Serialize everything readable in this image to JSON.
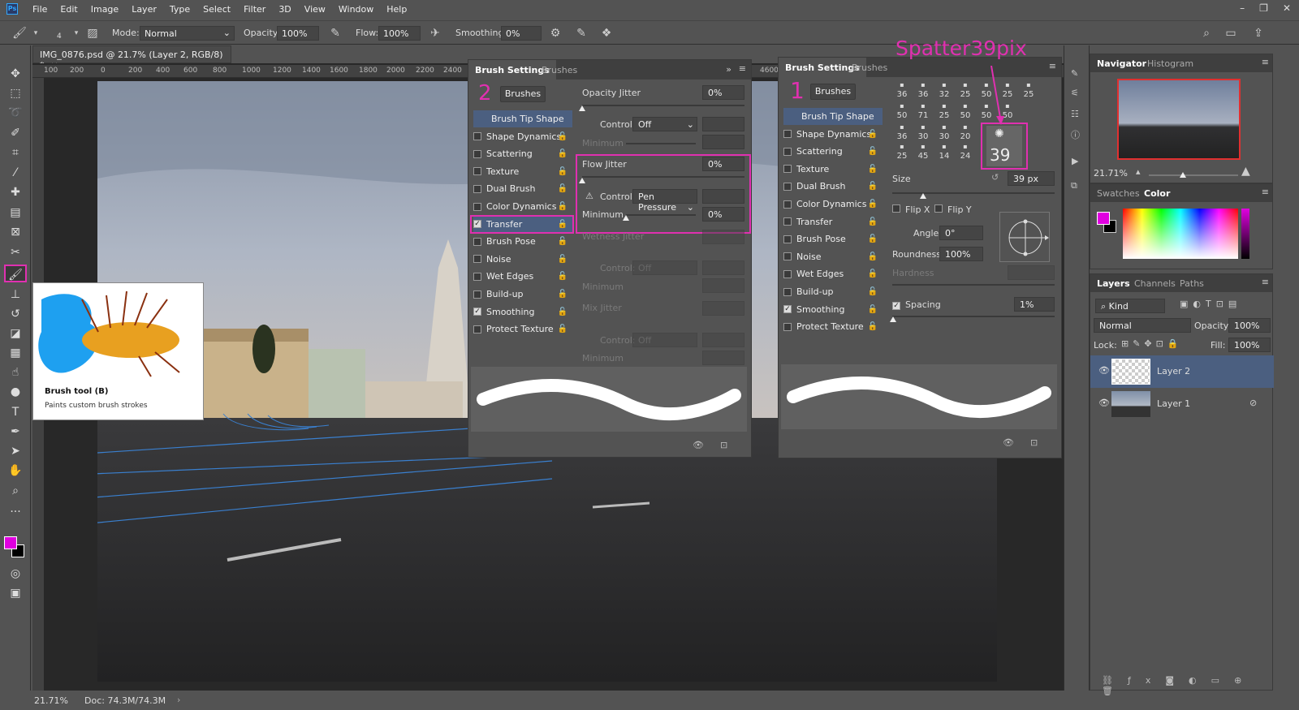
{
  "app": {
    "logo": "Ps"
  },
  "menu": [
    "File",
    "Edit",
    "Image",
    "Layer",
    "Type",
    "Select",
    "Filter",
    "3D",
    "View",
    "Window",
    "Help"
  ],
  "options": {
    "brush_size": "4",
    "mode_label": "Mode:",
    "mode_value": "Normal",
    "opacity_label": "Opacity:",
    "opacity_value": "100%",
    "flow_label": "Flow:",
    "flow_value": "100%",
    "smoothing_label": "Smoothing:",
    "smoothing_value": "0%"
  },
  "document": {
    "tab_title": "IMG_0876.psd @ 21.7% (Layer 2, RGB/8) *",
    "ruler_ticks": [
      "100",
      "200",
      "0",
      "200",
      "400",
      "600",
      "800",
      "1000",
      "1200",
      "1400",
      "1600",
      "1800",
      "2000",
      "2200",
      "2400",
      "4600"
    ],
    "zoom": "21.71%",
    "doc_size": "Doc: 74.3M/74.3M"
  },
  "tooltip": {
    "title": "Brush tool (B)",
    "desc": "Paints custom brush strokes"
  },
  "panel2": {
    "tab_active": "Brush Settings",
    "tab_other": "Brushes",
    "annotation": "2",
    "brushes_btn": "Brushes",
    "items": [
      {
        "label": "Brush Tip Shape",
        "checked": null
      },
      {
        "label": "Shape Dynamics",
        "checked": false
      },
      {
        "label": "Scattering",
        "checked": false
      },
      {
        "label": "Texture",
        "checked": false
      },
      {
        "label": "Dual Brush",
        "checked": false
      },
      {
        "label": "Color Dynamics",
        "checked": false
      },
      {
        "label": "Transfer",
        "checked": true
      },
      {
        "label": "Brush Pose",
        "checked": false
      },
      {
        "label": "Noise",
        "checked": false
      },
      {
        "label": "Wet Edges",
        "checked": false
      },
      {
        "label": "Build-up",
        "checked": false
      },
      {
        "label": "Smoothing",
        "checked": true
      },
      {
        "label": "Protect Texture",
        "checked": false
      }
    ],
    "opacity_jitter_label": "Opacity Jitter",
    "opacity_jitter_value": "0%",
    "control_label": "Control:",
    "control1_value": "Off",
    "minimum_label": "Minimum",
    "flow_jitter_label": "Flow Jitter",
    "flow_jitter_value": "0%",
    "control2_value": "Pen Pressure",
    "minimum2_value": "0%",
    "wetness_label": "Wetness Jitter",
    "control3_value": "Off",
    "mix_label": "Mix Jitter",
    "control4_value": "Off"
  },
  "panel1": {
    "tab_active": "Brush Settings",
    "tab_other": "Brushes",
    "annotation": "1",
    "brushes_btn": "Brushes",
    "items": [
      {
        "label": "Brush Tip Shape",
        "checked": null
      },
      {
        "label": "Shape Dynamics",
        "checked": false
      },
      {
        "label": "Scattering",
        "checked": false
      },
      {
        "label": "Texture",
        "checked": false
      },
      {
        "label": "Dual Brush",
        "checked": false
      },
      {
        "label": "Color Dynamics",
        "checked": false
      },
      {
        "label": "Transfer",
        "checked": false
      },
      {
        "label": "Brush Pose",
        "checked": false
      },
      {
        "label": "Noise",
        "checked": false
      },
      {
        "label": "Wet Edges",
        "checked": false
      },
      {
        "label": "Build-up",
        "checked": false
      },
      {
        "label": "Smoothing",
        "checked": true
      },
      {
        "label": "Protect Texture",
        "checked": false
      }
    ],
    "tip_row1": [
      "36",
      "36",
      "32",
      "25",
      "50",
      "25",
      "25"
    ],
    "tip_row2": [
      "50",
      "71",
      "25",
      "50",
      "50",
      "50"
    ],
    "tip_row3": [
      "36",
      "30",
      "30",
      "20"
    ],
    "tip_row4": [
      "25",
      "45",
      "14",
      "24"
    ],
    "selected_tip": "39",
    "callout": "Spatter39pix",
    "size_label": "Size",
    "size_value": "39 px",
    "flipx": "Flip X",
    "flipy": "Flip Y",
    "angle_label": "Angle:",
    "angle_value": "0°",
    "roundness_label": "Roundness:",
    "roundness_value": "100%",
    "hardness_label": "Hardness",
    "spacing_label": "Spacing",
    "spacing_value": "1%"
  },
  "navigator": {
    "tab_active": "Navigator",
    "tab_other": "Histogram",
    "zoom": "21.71%"
  },
  "color": {
    "tab_other": "Swatches",
    "tab_active": "Color",
    "foreground": "#e000e0",
    "background": "#000000"
  },
  "layers": {
    "tabs": [
      "Layers",
      "Channels",
      "Paths"
    ],
    "kind": "Kind",
    "blend": "Normal",
    "opacity_label": "Opacity:",
    "opacity_value": "100%",
    "lock_label": "Lock:",
    "fill_label": "Fill:",
    "fill_value": "100%",
    "rows": [
      {
        "name": "Layer 2"
      },
      {
        "name": "Layer 1"
      }
    ]
  }
}
